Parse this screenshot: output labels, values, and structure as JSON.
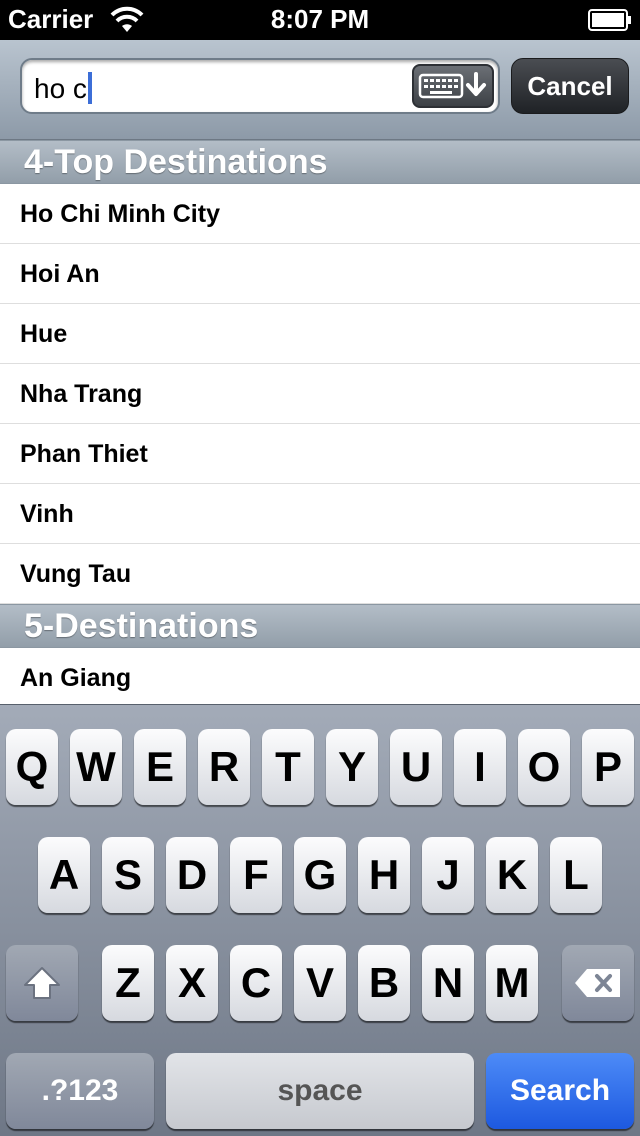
{
  "status_bar": {
    "carrier": "Carrier",
    "time": "8:07 PM"
  },
  "search": {
    "value": "ho c",
    "cancel_label": "Cancel"
  },
  "sections": [
    {
      "header": "4-Top Destinations",
      "rows": [
        "Ho Chi Minh City",
        "Hoi An",
        "Hue",
        "Nha Trang",
        "Phan Thiet",
        "Vinh",
        "Vung Tau"
      ]
    },
    {
      "header": "5-Destinations",
      "rows": [
        "An Giang"
      ]
    }
  ],
  "keyboard": {
    "row1": [
      "Q",
      "W",
      "E",
      "R",
      "T",
      "Y",
      "U",
      "I",
      "O",
      "P"
    ],
    "row2": [
      "A",
      "S",
      "D",
      "F",
      "G",
      "H",
      "J",
      "K",
      "L"
    ],
    "row3": [
      "Z",
      "X",
      "C",
      "V",
      "B",
      "N",
      "M"
    ],
    "numbers_label": ".?123",
    "space_label": "space",
    "search_label": "Search"
  }
}
